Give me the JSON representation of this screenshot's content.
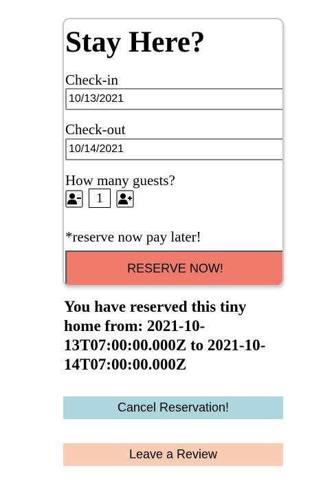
{
  "booking_card": {
    "title": "Stay Here?",
    "checkin_label": "Check-in",
    "checkin_value": "10/13/2021",
    "checkout_label": "Check-out",
    "checkout_value": "10/14/2021",
    "guests_label": "How many guests?",
    "guest_count": "1",
    "remove_guest_icon": "user-minus-icon",
    "add_guest_icon": "user-plus-icon",
    "note": "*reserve now pay later!",
    "reserve_label": "RESERVE NOW!"
  },
  "reservation": {
    "message": "You have reserved this tiny home from: 2021-10-13T07:00:00.000Z to 2021-10-14T07:00:00.000Z",
    "cancel_label": "Cancel Reservation!",
    "review_label": "Leave a Review"
  },
  "colors": {
    "reserve_button": "#f07b6a",
    "cancel_button": "#acd7de",
    "review_button": "#f8cdb3"
  }
}
